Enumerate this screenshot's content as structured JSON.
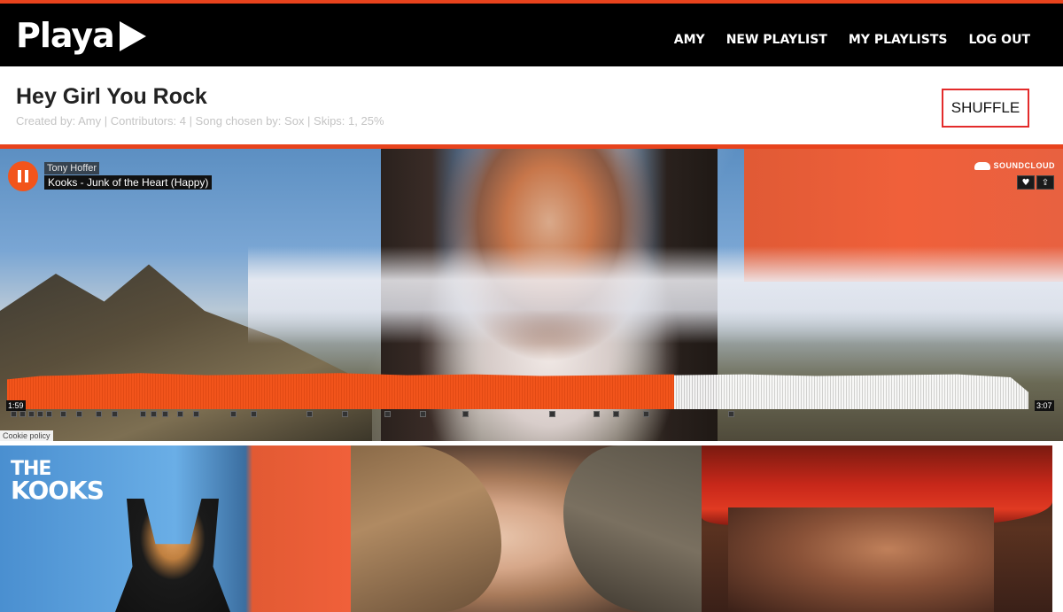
{
  "brand": {
    "name": "Playa"
  },
  "nav": {
    "items": [
      "AMY",
      "NEW PLAYLIST",
      "MY PLAYLISTS",
      "LOG OUT"
    ]
  },
  "playlist": {
    "title": "Hey Girl You Rock",
    "meta": "Created by: Amy | Contributors: 4 | Song chosen by: Sox | Skips: 1, 25%",
    "shuffle_label": "SHUFFLE"
  },
  "player": {
    "artist": "Tony Hoffer",
    "track": "Kooks - Junk of the Heart (Happy)",
    "provider": "SOUNDCLOUD",
    "elapsed": "1:59",
    "duration": "3:07",
    "progress": 0.64,
    "cookie_policy": "Cookie policy",
    "like_icon": "heart-icon",
    "share_icon": "share-icon"
  },
  "albums": [
    {
      "cover_text_line1": "THE",
      "cover_text_line2": "KOOKS"
    },
    {
      "cover_text_line1": "",
      "cover_text_line2": ""
    },
    {
      "cover_text_line1": "",
      "cover_text_line2": ""
    }
  ],
  "colors": {
    "accent": "#e8431d",
    "shuffle_border": "#e32b2b",
    "waveform_played": "#f2541b"
  }
}
